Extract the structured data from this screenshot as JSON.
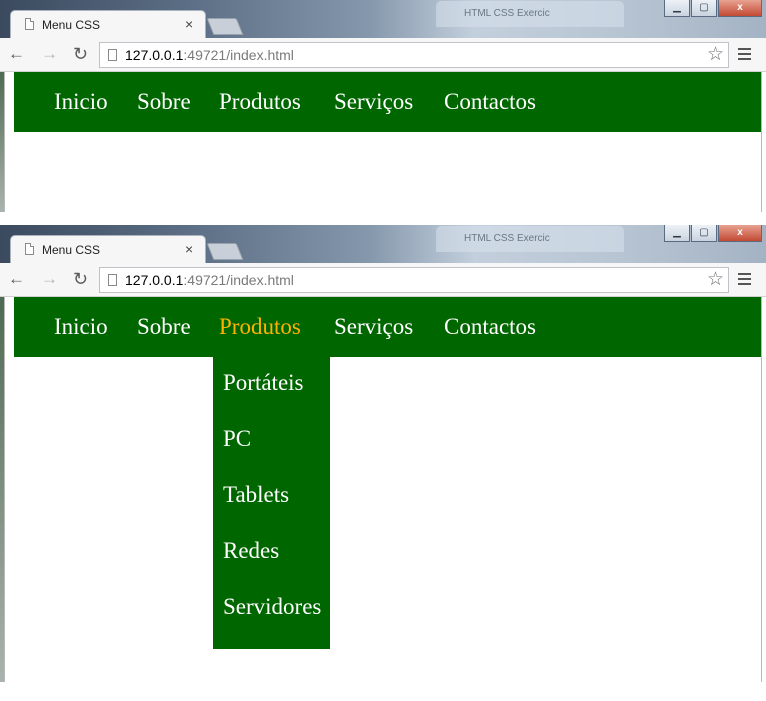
{
  "screenshots": [
    {
      "tab": {
        "title": "Menu CSS",
        "close_glyph": "×"
      },
      "background_tab": {
        "title": "HTML CSS Exercic"
      },
      "url": {
        "host": "127.0.0.1",
        "rest": ":49721/index.html"
      },
      "window_controls": [
        "minimize",
        "maximize",
        "close"
      ],
      "menu": [
        "Inicio",
        "Sobre",
        "Produtos",
        "Serviços",
        "Contactos"
      ],
      "active_item": null
    },
    {
      "tab": {
        "title": "Menu CSS",
        "close_glyph": "×"
      },
      "background_tab": {
        "title": "HTML CSS Exercic"
      },
      "url": {
        "host": "127.0.0.1",
        "rest": ":49721/index.html"
      },
      "window_controls": [
        "minimize",
        "maximize",
        "close"
      ],
      "menu": [
        "Inicio",
        "Sobre",
        "Produtos",
        "Serviços",
        "Contactos"
      ],
      "active_item": "Produtos",
      "submenu": [
        "Portáteis",
        "PC",
        "Tablets",
        "Redes",
        "Servidores"
      ]
    }
  ],
  "colors": {
    "menu_background": "#006600",
    "menu_text": "#ffffff",
    "menu_hover_text": "#ffb300"
  },
  "icons": {
    "back": "←",
    "forward": "→",
    "reload": "↻",
    "star": "☆",
    "minimize": "▁",
    "maximize": "▢",
    "close": "x"
  }
}
